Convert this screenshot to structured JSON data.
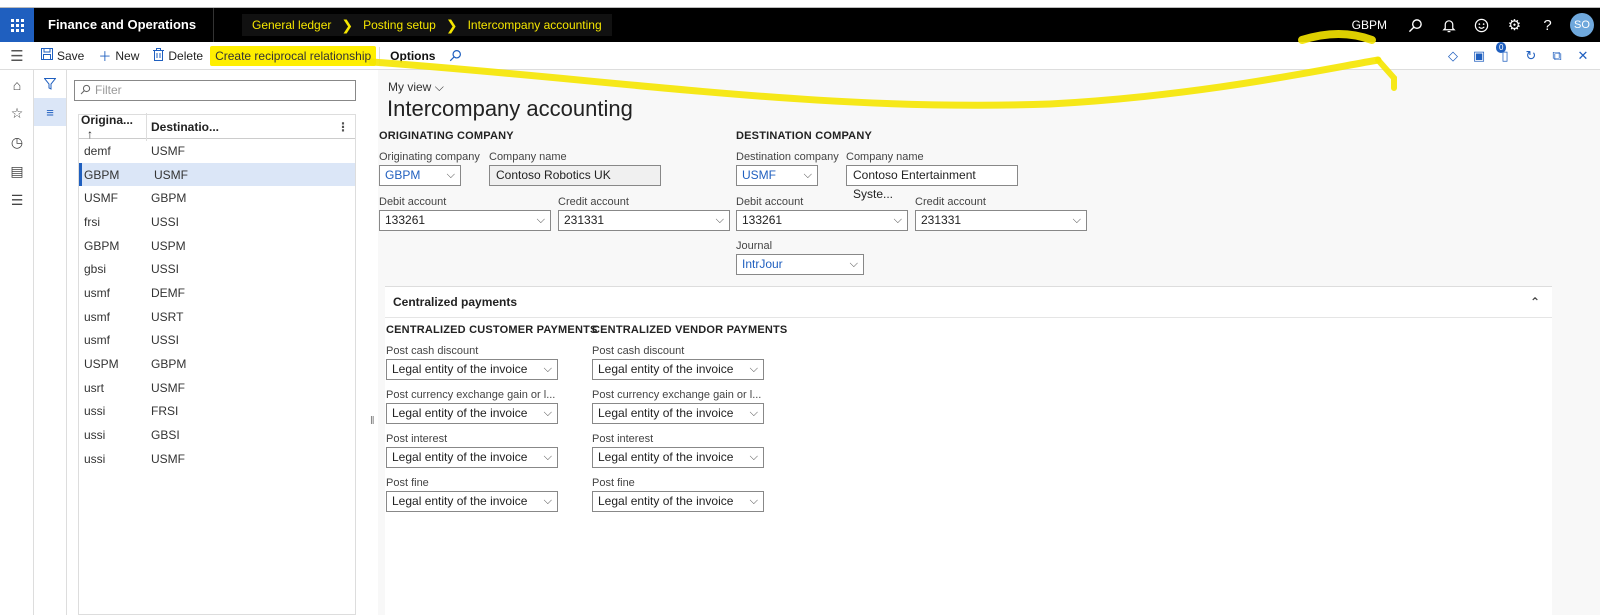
{
  "topbar": {
    "app_title": "Finance and Operations",
    "breadcrumb": [
      "General ledger",
      "Posting setup",
      "Intercompany accounting"
    ],
    "company": "GBPM",
    "avatar_initials": "SO",
    "icons": [
      "search-icon",
      "bell-icon",
      "smiley-icon",
      "gear-icon",
      "help-icon"
    ]
  },
  "actions": {
    "save": "Save",
    "new": "New",
    "delete": "Delete",
    "create_reciprocal": "Create reciprocal relationship",
    "options": "Options",
    "badge_count": "0"
  },
  "list": {
    "filter_placeholder": "Filter",
    "col1": "Origina...",
    "col2": "Destinatio...",
    "rows": [
      {
        "orig": "demf",
        "dest": "USMF"
      },
      {
        "orig": "GBPM",
        "dest": "USMF"
      },
      {
        "orig": "USMF",
        "dest": "GBPM"
      },
      {
        "orig": "frsi",
        "dest": "USSI"
      },
      {
        "orig": "GBPM",
        "dest": "USPM"
      },
      {
        "orig": "gbsi",
        "dest": "USSI"
      },
      {
        "orig": "usmf",
        "dest": "DEMF"
      },
      {
        "orig": "usmf",
        "dest": "USRT"
      },
      {
        "orig": "usmf",
        "dest": "USSI"
      },
      {
        "orig": "USPM",
        "dest": "GBPM"
      },
      {
        "orig": "usrt",
        "dest": "USMF"
      },
      {
        "orig": "ussi",
        "dest": "FRSI"
      },
      {
        "orig": "ussi",
        "dest": "GBSI"
      },
      {
        "orig": "ussi",
        "dest": "USMF"
      }
    ],
    "selected_index": 1
  },
  "main": {
    "my_view": "My view",
    "title": "Intercompany accounting",
    "originating": {
      "section": "ORIGINATING COMPANY",
      "company_label": "Originating company",
      "company_value": "GBPM",
      "name_label": "Company name",
      "name_value": "Contoso Robotics UK",
      "debit_label": "Debit account",
      "debit_value": "133261",
      "credit_label": "Credit account",
      "credit_value": "231331"
    },
    "destination": {
      "section": "DESTINATION COMPANY",
      "company_label": "Destination company",
      "company_value": "USMF",
      "name_label": "Company name",
      "name_value": "Contoso Entertainment Syste...",
      "debit_label": "Debit account",
      "debit_value": "133261",
      "credit_label": "Credit account",
      "credit_value": "231331",
      "journal_label": "Journal",
      "journal_value": "IntrJour"
    },
    "centralized": {
      "title": "Centralized payments",
      "customer_section": "CENTRALIZED CUSTOMER PAYMENTS",
      "vendor_section": "CENTRALIZED VENDOR PAYMENTS",
      "fields": [
        {
          "label": "Post cash discount",
          "value": "Legal entity of the invoice"
        },
        {
          "label": "Post currency exchange gain or l...",
          "value": "Legal entity of the invoice"
        },
        {
          "label": "Post interest",
          "value": "Legal entity of the invoice"
        },
        {
          "label": "Post fine",
          "value": "Legal entity of the invoice"
        }
      ]
    }
  },
  "colors": {
    "accent": "#1f5fbf",
    "highlight": "#ffef00",
    "topbar": "#000000"
  }
}
